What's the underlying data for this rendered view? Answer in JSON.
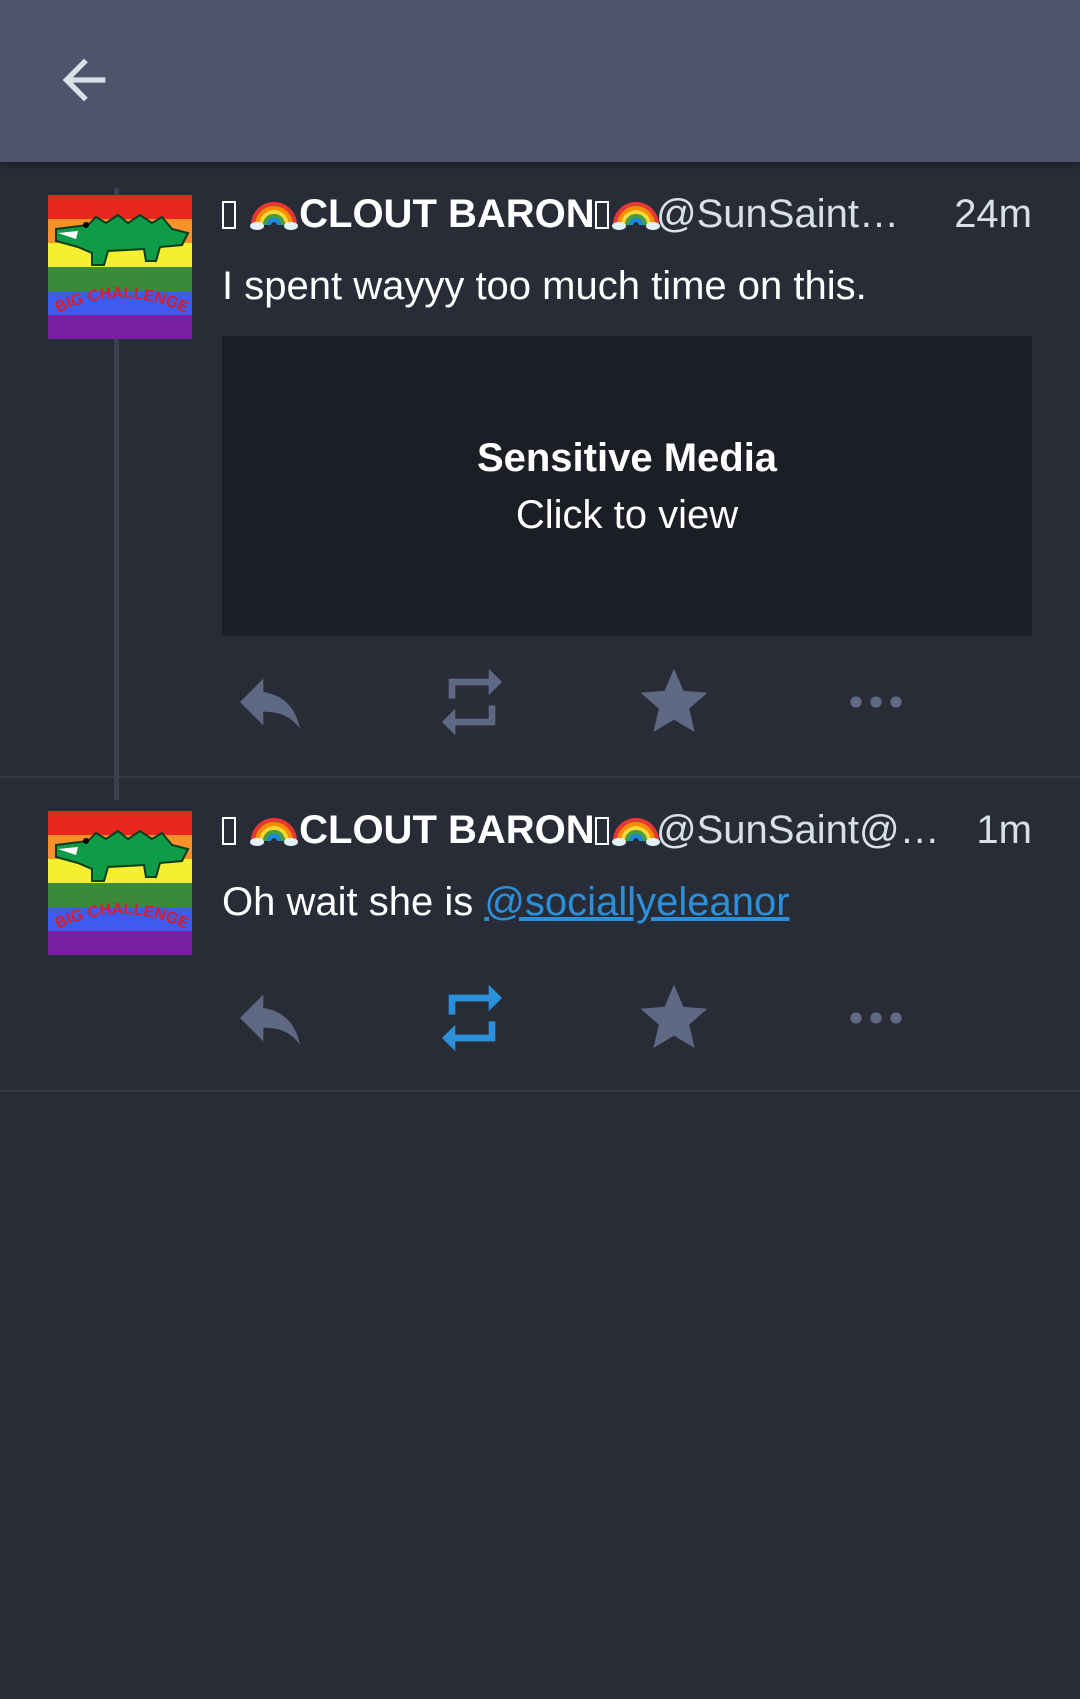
{
  "topbar": {
    "back_icon": "arrow-left-icon"
  },
  "colors": {
    "background": "#282c37",
    "topbar": "#4e546a",
    "icon_default": "#606984",
    "accent": "#2b90d9",
    "media_bg": "#1b1e24"
  },
  "statuses": [
    {
      "display_name": "CLOUT BARON",
      "account": "@SunSaint@…",
      "time": "24m",
      "content": "I spent wayyy too much time on this.",
      "media": {
        "title": "Sensitive Media",
        "subtitle": "Click to view"
      },
      "reblogged": false
    },
    {
      "display_name": "CLOUT BARON",
      "account": "@SunSaint@wi…",
      "time": "1m",
      "content_prefix": "Oh wait she is ",
      "mention": "@sociallyeleanor",
      "reblogged": true
    }
  ],
  "avatar": {
    "text": "BIG CHALLENGE!"
  }
}
